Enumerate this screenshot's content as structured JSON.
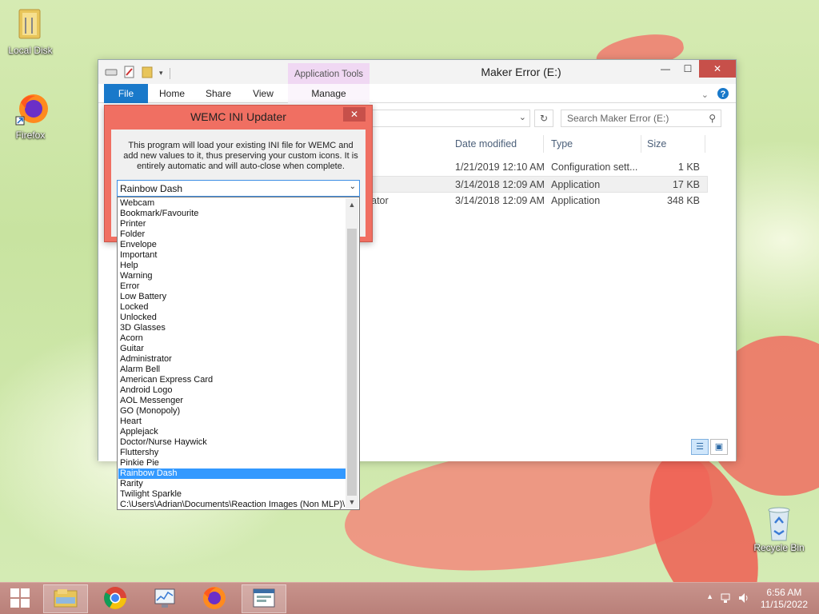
{
  "desktop": {
    "icons": [
      {
        "label": "Local Disk"
      },
      {
        "label": "Firefox"
      },
      {
        "label": "Recycle Bin"
      }
    ]
  },
  "explorer": {
    "title": "Maker Error (E:)",
    "contextual_tab": "Application Tools",
    "ribbon_tabs": {
      "file": "File",
      "home": "Home",
      "share": "Share",
      "view": "View",
      "manage": "Manage"
    },
    "search_placeholder": "Search Maker Error (E:)",
    "columns": {
      "date": "Date modified",
      "type": "Type",
      "size": "Size"
    },
    "files": [
      {
        "name": "",
        "date": "1/21/2019 12:10 AM",
        "type": "Configuration sett...",
        "size": "1 KB"
      },
      {
        "name": "",
        "date": "3/14/2018 12:09 AM",
        "type": "Application",
        "size": "17 KB"
      },
      {
        "name": "reator",
        "date": "3/14/2018 12:09 AM",
        "type": "Application",
        "size": "348 KB"
      }
    ]
  },
  "dialog": {
    "title": "WEMC INI Updater",
    "description": "This program will load your existing INI file for WEMC and add new values to it, thus preserving your custom icons. It is entirely automatic and will auto-close when complete.",
    "selected": "Rainbow Dash",
    "options": [
      "Webcam",
      "Bookmark/Favourite",
      "Printer",
      "Folder",
      "Envelope",
      "Important",
      "Help",
      "Warning",
      "Error",
      "Low Battery",
      "Locked",
      "Unlocked",
      "3D Glasses",
      "Acorn",
      "Guitar",
      "Administrator",
      "Alarm Bell",
      "American Express Card",
      "Android Logo",
      "AOL Messenger",
      "GO (Monopoly)",
      "Heart",
      "Applejack",
      "Doctor/Nurse Haywick",
      "Fluttershy",
      "Pinkie Pie",
      "Rainbow Dash",
      "Rarity",
      "Twilight Sparkle",
      "C:\\Users\\Adrian\\Documents\\Reaction Images (Non MLP)\\"
    ]
  },
  "taskbar": {
    "time": "6:56 AM",
    "date": "11/15/2022"
  }
}
